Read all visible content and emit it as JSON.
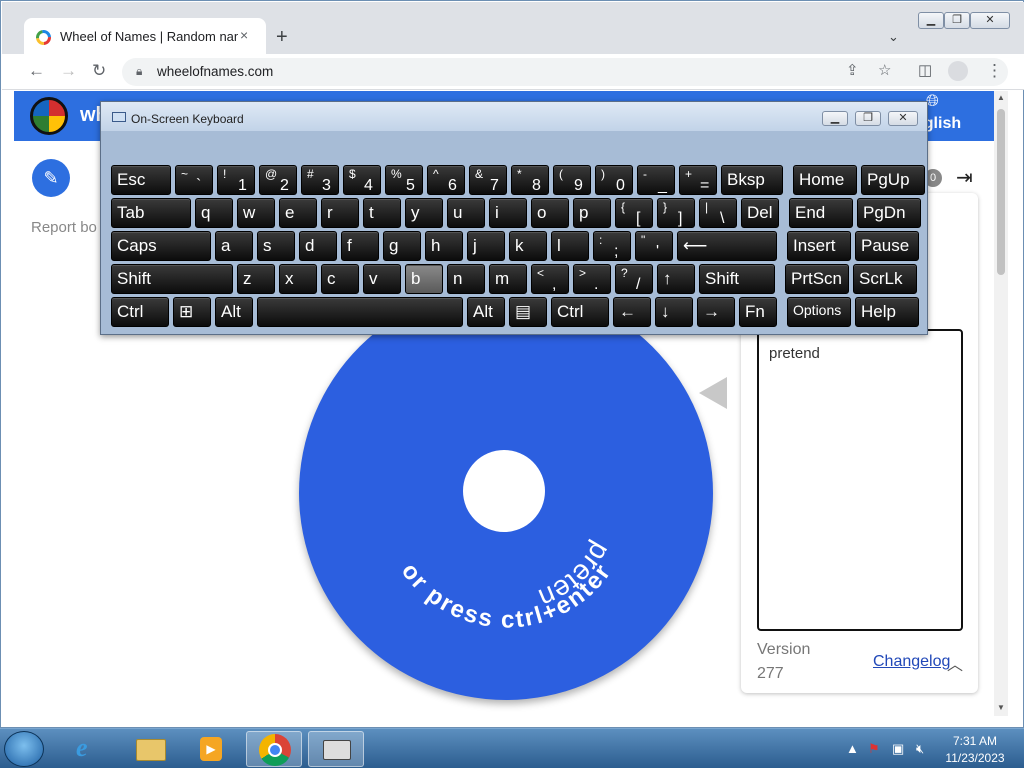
{
  "browser": {
    "tab_title": "Wheel of Names | Random name",
    "tab_close": "×",
    "new_tab": "+",
    "url": "wheelofnames.com"
  },
  "page": {
    "brand": "wh",
    "language": "nglish",
    "report": "Report bo",
    "wheel_text_top": "pretend",
    "wheel_text": "or press ctrl+enter",
    "count": "0",
    "entries_text": "pretend",
    "version_label": "Version",
    "version_number": "277",
    "changelog": "Changelog"
  },
  "osk": {
    "title": "On-Screen Keyboard",
    "rows": [
      [
        {
          "label": "Esc"
        },
        {
          "shift": "~",
          "main": "`"
        },
        {
          "shift": "!",
          "main": "1"
        },
        {
          "shift": "@",
          "main": "2"
        },
        {
          "shift": "#",
          "main": "3"
        },
        {
          "shift": "$",
          "main": "4"
        },
        {
          "shift": "%",
          "main": "5"
        },
        {
          "shift": "^",
          "main": "6"
        },
        {
          "shift": "&",
          "main": "7"
        },
        {
          "shift": "*",
          "main": "8"
        },
        {
          "shift": "(",
          "main": "9"
        },
        {
          "shift": ")",
          "main": "0"
        },
        {
          "shift": "-",
          "main": "_"
        },
        {
          "shift": "+",
          "main": "="
        },
        {
          "label": "Bksp"
        },
        {
          "label": "Home"
        },
        {
          "label": "PgUp"
        }
      ],
      [
        {
          "label": "Tab"
        },
        {
          "label": "q"
        },
        {
          "label": "w"
        },
        {
          "label": "e"
        },
        {
          "label": "r"
        },
        {
          "label": "t"
        },
        {
          "label": "y"
        },
        {
          "label": "u"
        },
        {
          "label": "i"
        },
        {
          "label": "o"
        },
        {
          "label": "p"
        },
        {
          "shift": "{",
          "main": "["
        },
        {
          "shift": "}",
          "main": "]"
        },
        {
          "shift": "|",
          "main": "\\"
        },
        {
          "label": "Del"
        },
        {
          "label": "End"
        },
        {
          "label": "PgDn"
        }
      ],
      [
        {
          "label": "Caps"
        },
        {
          "label": "a"
        },
        {
          "label": "s"
        },
        {
          "label": "d"
        },
        {
          "label": "f"
        },
        {
          "label": "g"
        },
        {
          "label": "h"
        },
        {
          "label": "j"
        },
        {
          "label": "k"
        },
        {
          "label": "l"
        },
        {
          "shift": ":",
          "main": ";"
        },
        {
          "shift": "\"",
          "main": "'"
        },
        {
          "label": "⟵"
        },
        {
          "label": "Insert"
        },
        {
          "label": "Pause"
        }
      ],
      [
        {
          "label": "Shift"
        },
        {
          "label": "z"
        },
        {
          "label": "x"
        },
        {
          "label": "c"
        },
        {
          "label": "v"
        },
        {
          "label": "b"
        },
        {
          "label": "n"
        },
        {
          "label": "m"
        },
        {
          "shift": "<",
          "main": ","
        },
        {
          "shift": ">",
          "main": "."
        },
        {
          "shift": "?",
          "main": "/"
        },
        {
          "label": "↑"
        },
        {
          "label": "Shift"
        },
        {
          "label": "PrtScn"
        },
        {
          "label": "ScrLk"
        }
      ],
      [
        {
          "label": "Ctrl"
        },
        {
          "label": "⊞"
        },
        {
          "label": "Alt"
        },
        {
          "label": ""
        },
        {
          "label": "Alt"
        },
        {
          "label": "▤"
        },
        {
          "label": "Ctrl"
        },
        {
          "label": "←"
        },
        {
          "label": "↓"
        },
        {
          "label": "→"
        },
        {
          "label": "Fn"
        },
        {
          "label": "Options"
        },
        {
          "label": "Help"
        }
      ]
    ]
  },
  "taskbar": {
    "time": "7:31 AM",
    "date": "11/23/2023"
  }
}
